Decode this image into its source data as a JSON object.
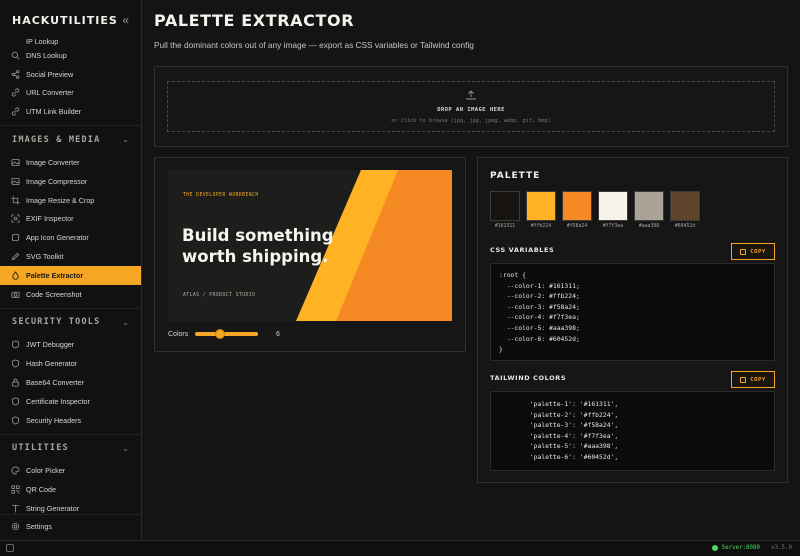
{
  "app": {
    "brand": "HACKUTILITIES"
  },
  "sidebar": {
    "cut_item": "IP Lookup",
    "network_items": [
      {
        "label": "DNS Lookup",
        "icon": "search-icon"
      },
      {
        "label": "Social Preview",
        "icon": "share-icon"
      },
      {
        "label": "URL Converter",
        "icon": "link-icon"
      },
      {
        "label": "UTM Link Builder",
        "icon": "link-icon"
      }
    ],
    "sections": {
      "images": "IMAGES & MEDIA",
      "security": "SECURITY TOOLS",
      "utilities": "UTILITIES"
    },
    "image_items": [
      {
        "label": "Image Converter",
        "icon": "image-icon"
      },
      {
        "label": "Image Compressor",
        "icon": "image-icon"
      },
      {
        "label": "Image Resize & Crop",
        "icon": "crop-icon"
      },
      {
        "label": "EXIF Inspector",
        "icon": "scan-icon"
      },
      {
        "label": "App Icon Generator",
        "icon": "app-icon"
      },
      {
        "label": "SVG Toolkit",
        "icon": "pen-icon"
      },
      {
        "label": "Palette Extractor",
        "icon": "drop-icon",
        "active": true
      },
      {
        "label": "Code Screenshot",
        "icon": "camera-icon"
      }
    ],
    "security_items": [
      {
        "label": "JWT Debugger",
        "icon": "shield-icon"
      },
      {
        "label": "Hash Generator",
        "icon": "shield-icon"
      },
      {
        "label": "Base64 Converter",
        "icon": "lock-icon"
      },
      {
        "label": "Certificate Inspector",
        "icon": "shield-icon"
      },
      {
        "label": "Security Headers",
        "icon": "shield-icon"
      }
    ],
    "utility_items": [
      {
        "label": "Color Picker",
        "icon": "palette-icon"
      },
      {
        "label": "QR Code",
        "icon": "qr-icon"
      },
      {
        "label": "String Generator",
        "icon": "text-icon"
      }
    ],
    "settings": "Settings"
  },
  "page": {
    "title": "PALETTE EXTRACTOR",
    "subtitle": "Pull the dominant colors out of any image — export as CSS variables or Tailwind config"
  },
  "dropzone": {
    "title": "DROP AN IMAGE HERE",
    "hint": "or click to browse (jpg, jpg, jpeg, webp, gif, bmp)"
  },
  "preview": {
    "eyebrow": "THE DEVELOPER WORKBENCH",
    "headline": "Build something worth shipping.",
    "footer": "ATLAS / PRODUCT STUDIO",
    "colors_label": "Colors",
    "colors_value": "6",
    "colors_range": [
      2,
      12
    ]
  },
  "palette": {
    "title": "PALETTE",
    "swatches": [
      "#161311",
      "#ffb224",
      "#f58a24",
      "#f7f3ea",
      "#aaa398",
      "#60452d"
    ],
    "css_title": "CSS VARIABLES",
    "tailwind_title": "TAILWIND COLORS",
    "copy_label": "COPY",
    "css_code": ":root {\n  --color-1: #161311;\n  --color-2: #ffb224;\n  --color-3: #f58a24;\n  --color-4: #f7f3ea;\n  --color-5: #aaa398;\n  --color-6: #60452d;\n}",
    "tailwind_code": "        'palette-1': '#161311',\n        'palette-2': '#ffb224',\n        'palette-3': '#f58a24',\n        'palette-4': '#f7f3ea',\n        'palette-5': '#aaa398',\n        'palette-6': '#60452d',"
  },
  "status": {
    "server": "Server:8080",
    "version": "v3.5.0"
  },
  "colors": {
    "accent": "#f5a623",
    "online": "#4cd964"
  }
}
